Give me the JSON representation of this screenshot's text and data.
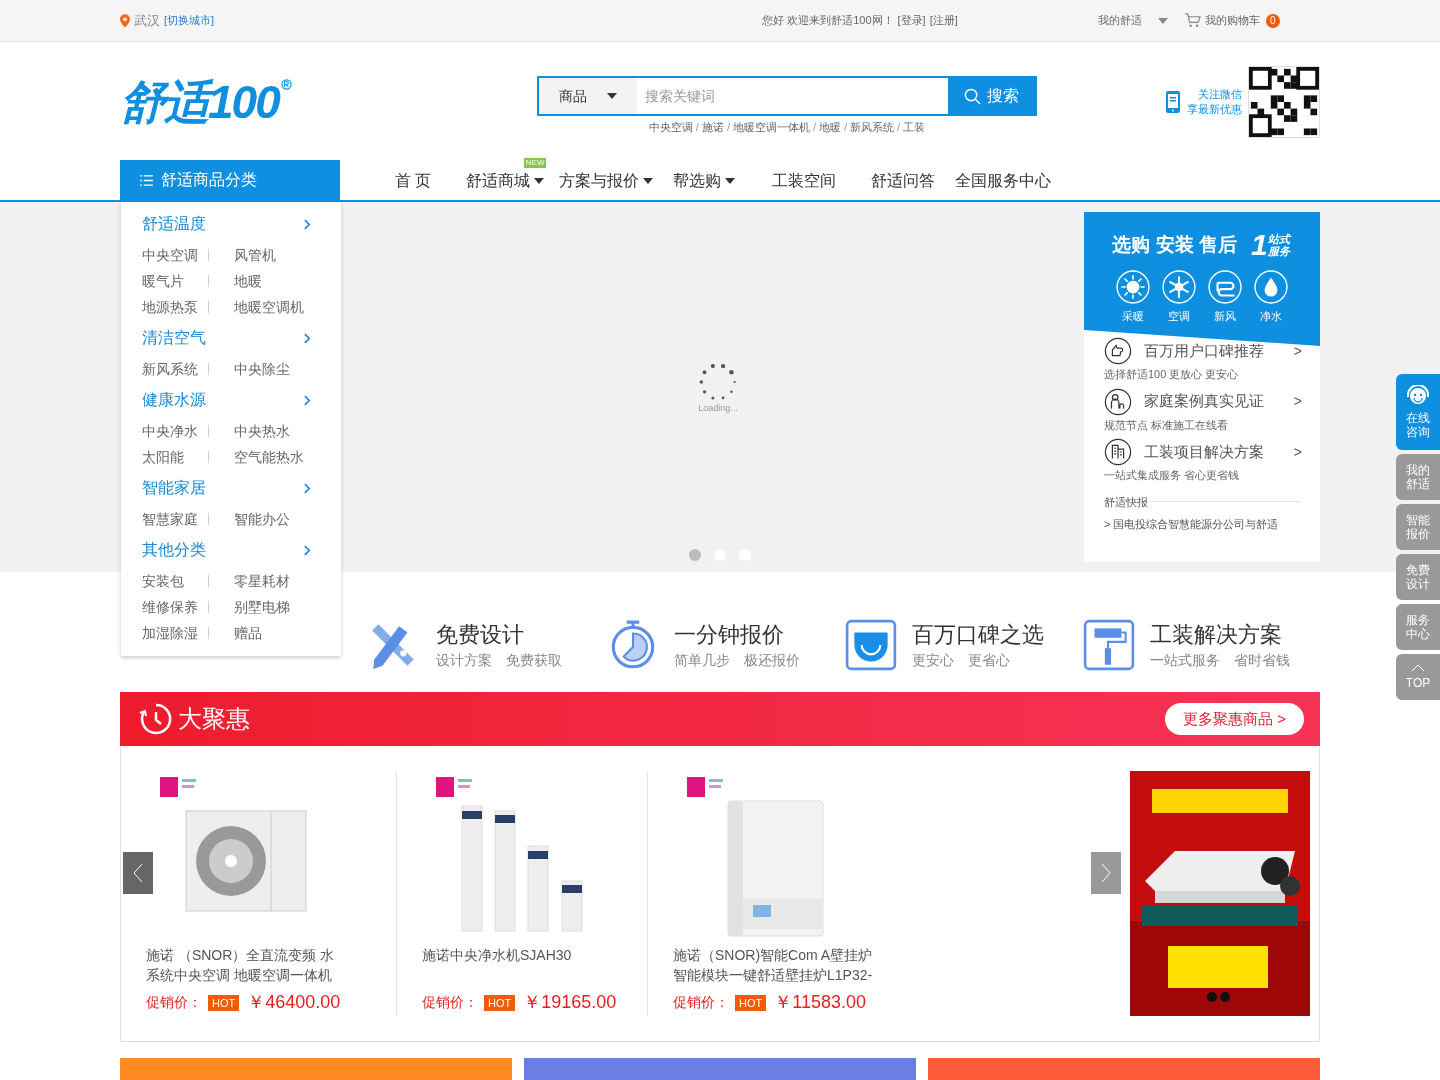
{
  "top_bar": {
    "city": "武汉",
    "switch_city": "[切换城市]",
    "welcome": "您好 欢迎来到舒适100网！",
    "login": "[登录]",
    "register": "[注册]",
    "my_account": "我的舒适",
    "cart": "我的购物车",
    "cart_count": "0"
  },
  "header": {
    "logo": "舒适100",
    "search": {
      "scope": "商品",
      "placeholder": "搜索关键词",
      "button": "搜索"
    },
    "hot_keywords": [
      "中央空调",
      "施诺",
      "地暖空调一体机",
      "地暖",
      "新风系统",
      "工装"
    ],
    "keyword_separator": "/",
    "wechat": [
      "关注微信",
      "享最新优惠"
    ]
  },
  "category_button": "舒适商品分类",
  "nav": [
    {
      "label": "首 页",
      "dropdown": false
    },
    {
      "label": "舒适商城",
      "dropdown": true,
      "badge": "NEW"
    },
    {
      "label": "方案与报价",
      "dropdown": true
    },
    {
      "label": "帮选购",
      "dropdown": true
    },
    {
      "label": "工装空间",
      "dropdown": false
    },
    {
      "label": "舒适问答",
      "dropdown": false
    },
    {
      "label": "全国服务中心",
      "dropdown": false
    }
  ],
  "categories": [
    {
      "title": "舒适温度",
      "rows": [
        [
          "中央空调",
          "风管机"
        ],
        [
          "暖气片",
          "地暖"
        ],
        [
          "地源热泵",
          "地暖空调机"
        ]
      ]
    },
    {
      "title": "清洁空气",
      "rows": [
        [
          "新风系统",
          "中央除尘"
        ]
      ]
    },
    {
      "title": "健康水源",
      "rows": [
        [
          "中央净水",
          "中央热水"
        ],
        [
          "太阳能",
          "空气能热水"
        ]
      ]
    },
    {
      "title": "智能家居",
      "rows": [
        [
          "智慧家庭",
          "智能办公"
        ]
      ]
    },
    {
      "title": "其他分类",
      "rows": [
        [
          "安装包",
          "零星耗材"
        ],
        [
          "维修保养",
          "别墅电梯"
        ],
        [
          "加湿除湿",
          "赠品"
        ]
      ]
    }
  ],
  "banner": {
    "loading": "Loading...",
    "dots": [
      {
        "selected": true
      },
      {
        "selected": false
      },
      {
        "selected": false
      }
    ]
  },
  "service_panel": {
    "title": "选购 安装 售后",
    "badge": {
      "digit": "1",
      "text": "站式服务"
    },
    "services": [
      {
        "label": "采暖",
        "kind": "sun"
      },
      {
        "label": "空调",
        "kind": "snow"
      },
      {
        "label": "新风",
        "kind": "air"
      },
      {
        "label": "净水",
        "kind": "drop"
      }
    ],
    "items": [
      {
        "title": "百万用户口碑推荐",
        "subtitle": "选择舒适100  更放心  更安心",
        "kind": "thumb",
        "arrow": ">"
      },
      {
        "title": "家庭案例真实见证",
        "subtitle": "规范节点  标准施工在线看",
        "kind": "family",
        "arrow": ">"
      },
      {
        "title": "工装项目解决方案",
        "subtitle": "一站式集成服务  省心更省钱",
        "kind": "building",
        "arrow": ">"
      }
    ],
    "news": {
      "title": "舒适快报",
      "items": [
        "> 国电投综合智慧能源分公司与舒适"
      ]
    }
  },
  "features": [
    {
      "title": "免费设计",
      "subtitle": [
        "设计方案",
        "免费获取"
      ],
      "kind": "pencil"
    },
    {
      "title": "一分钟报价",
      "subtitle": [
        "简单几步",
        "极还报价"
      ],
      "kind": "timer"
    },
    {
      "title": "百万口碑之选",
      "subtitle": [
        "更安心",
        "更省心"
      ],
      "kind": "smile"
    },
    {
      "title": "工装解决方案",
      "subtitle": [
        "一站式服务",
        "省时省钱"
      ],
      "kind": "roller"
    }
  ],
  "deals": {
    "title": "大聚惠",
    "more": "更多聚惠商品 >",
    "products": [
      {
        "name": "施诺 （SNOR）全直流变频 水系统中央空调 地暖空调一体机",
        "price_label": "促销价：",
        "tag": "HOT",
        "price": "￥46400.00",
        "kind": "outdoor-unit"
      },
      {
        "name": "施诺中央净水机SJAH30",
        "price_label": "促销价：",
        "tag": "HOT",
        "price": "￥19165.00",
        "kind": "water-filters"
      },
      {
        "name": "施诺（SNOR)智能Com A壁挂炉智能模块一键舒适壁挂炉L1P32-",
        "price_label": "促销价：",
        "tag": "HOT",
        "price": "￥11583.00",
        "kind": "boiler"
      }
    ]
  },
  "bottom_sections": [
    {
      "color": "#ff8a22"
    },
    {
      "color": "#6a7fe6"
    },
    {
      "color": "#ff5a3a"
    }
  ],
  "side_tools": [
    {
      "lines": [
        "在线",
        "咨询"
      ],
      "selected": true,
      "kind": "chat"
    },
    {
      "lines": [
        "我的",
        "舒适"
      ],
      "selected": false,
      "kind": "text"
    },
    {
      "lines": [
        "智能",
        "报价"
      ],
      "selected": false,
      "kind": "text"
    },
    {
      "lines": [
        "免费",
        "设计"
      ],
      "selected": false,
      "kind": "text"
    },
    {
      "lines": [
        "服务",
        "中心"
      ],
      "selected": false,
      "kind": "text"
    },
    {
      "lines": [
        "TOP"
      ],
      "selected": false,
      "kind": "top"
    }
  ]
}
